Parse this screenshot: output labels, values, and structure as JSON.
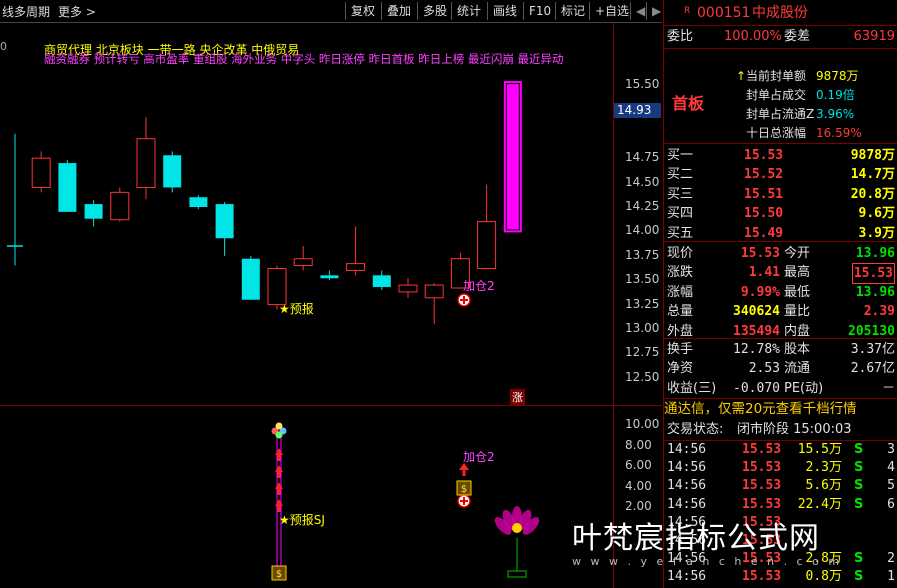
{
  "toolbar": {
    "left_items": [
      "线",
      "多周期",
      "更多 >"
    ],
    "buttons": [
      "复权",
      "叠加",
      "多股",
      "统计",
      "画线",
      "F10",
      "标记",
      "+自选"
    ],
    "nav_back": "◀",
    "nav_forward": "▶"
  },
  "chart": {
    "top_axis_zero": "0",
    "concept_line1": "商贸代理 北京板块 一带一路 央企改革 中俄贸易",
    "concept_line2": "融资融券 预计转亏 高市盈率 重组股 海外业务 中字头 昨日涨停 昨日首板 昨日上榜 最近闪崩 最近异动",
    "price_label_current": "14.93",
    "yaxis_main": [
      "15.50",
      "15.25",
      "14.75",
      "14.50",
      "14.25",
      "14.00",
      "13.75",
      "13.50",
      "13.25",
      "13.00",
      "12.75",
      "12.50"
    ],
    "yaxis_sub": [
      "10.00",
      "8.00",
      "6.00",
      "4.00",
      "2.00"
    ],
    "annotations": {
      "yubao": "★预报",
      "jiacang": "加仓2",
      "jiacang_sub": "加仓2",
      "yubao_sj": "★预报SJ",
      "zhang_badge": "涨"
    },
    "colors": {
      "up": "#ff3333",
      "down": "#00e5e5",
      "limit_up": "#ff00ff"
    },
    "candles": [
      {
        "o": 13.83,
        "h": 14.75,
        "l": 14.15,
        "c": 13.83,
        "type": "doji"
      },
      {
        "o": 14.45,
        "c": 14.75,
        "h": 14.82,
        "l": 14.4
      },
      {
        "o": 14.7,
        "c": 14.2,
        "h": 14.73,
        "l": 14.2
      },
      {
        "o": 14.28,
        "c": 14.13,
        "h": 14.32,
        "l": 14.05
      },
      {
        "o": 14.12,
        "c": 14.4,
        "h": 14.45,
        "l": 14.1
      },
      {
        "o": 14.45,
        "c": 14.95,
        "h": 15.17,
        "l": 14.33
      },
      {
        "o": 14.78,
        "c": 14.45,
        "h": 14.82,
        "l": 14.4
      },
      {
        "o": 14.35,
        "c": 14.25,
        "h": 14.37,
        "l": 14.23
      },
      {
        "o": 14.28,
        "c": 13.93,
        "h": 14.3,
        "l": 13.75
      },
      {
        "o": 13.72,
        "c": 13.3,
        "h": 13.75,
        "l": 13.3
      },
      {
        "o": 13.25,
        "c": 13.62,
        "h": 13.65,
        "l": 13.2
      },
      {
        "o": 13.65,
        "c": 13.72,
        "h": 13.85,
        "l": 13.6
      },
      {
        "o": 13.55,
        "c": 13.52,
        "h": 13.6,
        "l": 13.5
      },
      {
        "o": 13.6,
        "c": 13.67,
        "h": 14.05,
        "l": 13.55
      },
      {
        "o": 13.55,
        "c": 13.43,
        "h": 13.6,
        "l": 13.4
      },
      {
        "o": 13.38,
        "c": 13.45,
        "h": 13.52,
        "l": 13.32
      },
      {
        "o": 13.32,
        "c": 13.45,
        "h": 13.47,
        "l": 13.05
      },
      {
        "o": 13.42,
        "c": 13.72,
        "h": 13.78,
        "l": 13.42
      },
      {
        "o": 13.62,
        "c": 14.1,
        "h": 14.48,
        "l": 13.62
      },
      {
        "o": 14.0,
        "c": 15.53,
        "h": 15.53,
        "l": 14.0,
        "limit": true
      }
    ]
  },
  "right": {
    "code_prefix": "R",
    "code": "000151",
    "name": "中成股份",
    "weibi_label": "委比",
    "weibi_value": "100.00%",
    "weicha_label": "委差",
    "weicha_value": "63919",
    "shouban": "首板",
    "seal": [
      {
        "label": "当前封单额",
        "value": "9878万",
        "bullet": "↑"
      },
      {
        "label": "封单占成交",
        "value": "0.19倍"
      },
      {
        "label": "封单占流通Z",
        "value": "3.96%"
      },
      {
        "label": "十日总涨幅",
        "value": "16.59%"
      }
    ],
    "buy": [
      {
        "label": "买一",
        "price": "15.53",
        "vol": "9878万"
      },
      {
        "label": "买二",
        "price": "15.52",
        "vol": "14.7万"
      },
      {
        "label": "买三",
        "price": "15.51",
        "vol": "20.8万"
      },
      {
        "label": "买四",
        "price": "15.50",
        "vol": "9.6万"
      },
      {
        "label": "买五",
        "price": "15.49",
        "vol": "3.9万"
      }
    ],
    "quote": [
      {
        "l1": "现价",
        "v1": "15.53",
        "l2": "今开",
        "v2": "13.96"
      },
      {
        "l1": "涨跌",
        "v1": "1.41",
        "l2": "最高",
        "v2": "15.53"
      },
      {
        "l1": "涨幅",
        "v1": "9.99%",
        "l2": "最低",
        "v2": "13.96"
      },
      {
        "l1": "总量",
        "v1": "340624",
        "l2": "量比",
        "v2": "2.39"
      },
      {
        "l1": "外盘",
        "v1": "135494",
        "l2": "内盘",
        "v2": "205130"
      }
    ],
    "fin": [
      {
        "l1": "换手",
        "v1": "12.78%",
        "l2": "股本",
        "v2": "3.37亿"
      },
      {
        "l1": "净资",
        "v1": "2.53",
        "l2": "流通",
        "v2": "2.67亿"
      },
      {
        "l1": "收益(三)",
        "v1": "-0.070",
        "l2": "PE(动)",
        "v2": "－"
      }
    ],
    "promo": "通达信，仅需20元查看千档行情",
    "status_label": "交易状态:",
    "status_value": "闭市阶段 15:00:03",
    "ticks": [
      {
        "t": "14:56",
        "p": "15.53",
        "v": "15.5万",
        "s": "S",
        "n": "3"
      },
      {
        "t": "14:56",
        "p": "15.53",
        "v": "2.3万",
        "s": "S",
        "n": "4"
      },
      {
        "t": "14:56",
        "p": "15.53",
        "v": "5.6万",
        "s": "S",
        "n": "5"
      },
      {
        "t": "14:56",
        "p": "15.53",
        "v": "22.4万",
        "s": "S",
        "n": "6"
      },
      {
        "t": "14:56",
        "p": "15.53",
        "v": "",
        "s": "",
        "n": ""
      },
      {
        "t": "14:56",
        "p": "15.53",
        "v": "",
        "s": "",
        "n": ""
      },
      {
        "t": "14:56",
        "p": "15.53",
        "v": "2.8万",
        "s": "S",
        "n": "2"
      },
      {
        "t": "14:56",
        "p": "15.53",
        "v": "0.8万",
        "s": "S",
        "n": "1"
      }
    ]
  },
  "watermark": {
    "text": "叶梵宸指标公式网",
    "url": "w w w . y e f a n c h e n . c o m"
  }
}
